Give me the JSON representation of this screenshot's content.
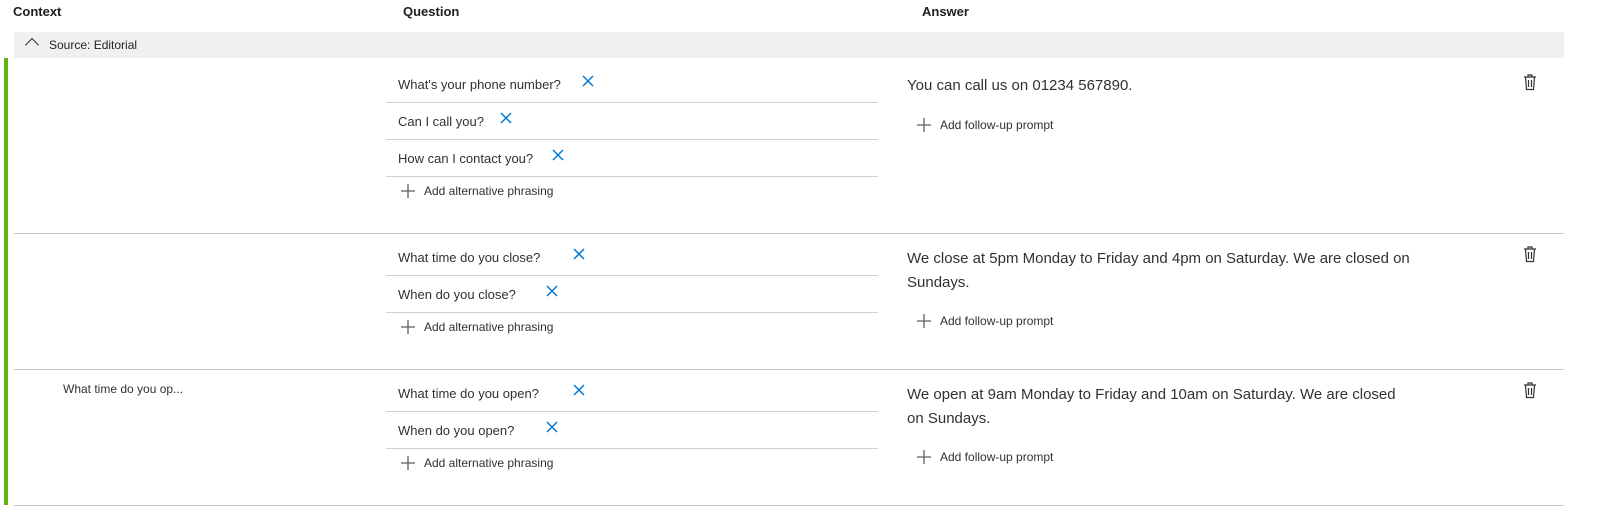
{
  "columns": {
    "context": "Context",
    "question": "Question",
    "answer": "Answer"
  },
  "source": {
    "label": "Source: Editorial"
  },
  "colors": {
    "accent": "#5fb515",
    "link": "#0078d4"
  },
  "rows": [
    {
      "context": "",
      "questions": [
        "What's your phone number?",
        "Can I call you?",
        "How can I contact you?"
      ],
      "add_phrasing": "Add alternative phrasing",
      "answer": "You can call us on 01234 567890.",
      "add_prompt": "Add follow-up prompt"
    },
    {
      "context": "",
      "questions": [
        "What time do you close?",
        "When do you close?"
      ],
      "add_phrasing": "Add alternative phrasing",
      "answer": "We close at 5pm Monday to Friday and 4pm on Saturday. We are closed on Sundays.",
      "add_prompt": "Add follow-up prompt"
    },
    {
      "context": "What time do you op...",
      "questions": [
        "What time do you open?",
        "When do you open?"
      ],
      "add_phrasing": "Add alternative phrasing",
      "answer": "We open at 9am Monday to Friday and 10am on Saturday. We are closed on Sundays.",
      "add_prompt": "Add follow-up prompt"
    }
  ],
  "icons": {
    "chevron": "chevron-up-icon",
    "remove": "close-icon",
    "add": "plus-icon",
    "delete": "trash-icon"
  }
}
